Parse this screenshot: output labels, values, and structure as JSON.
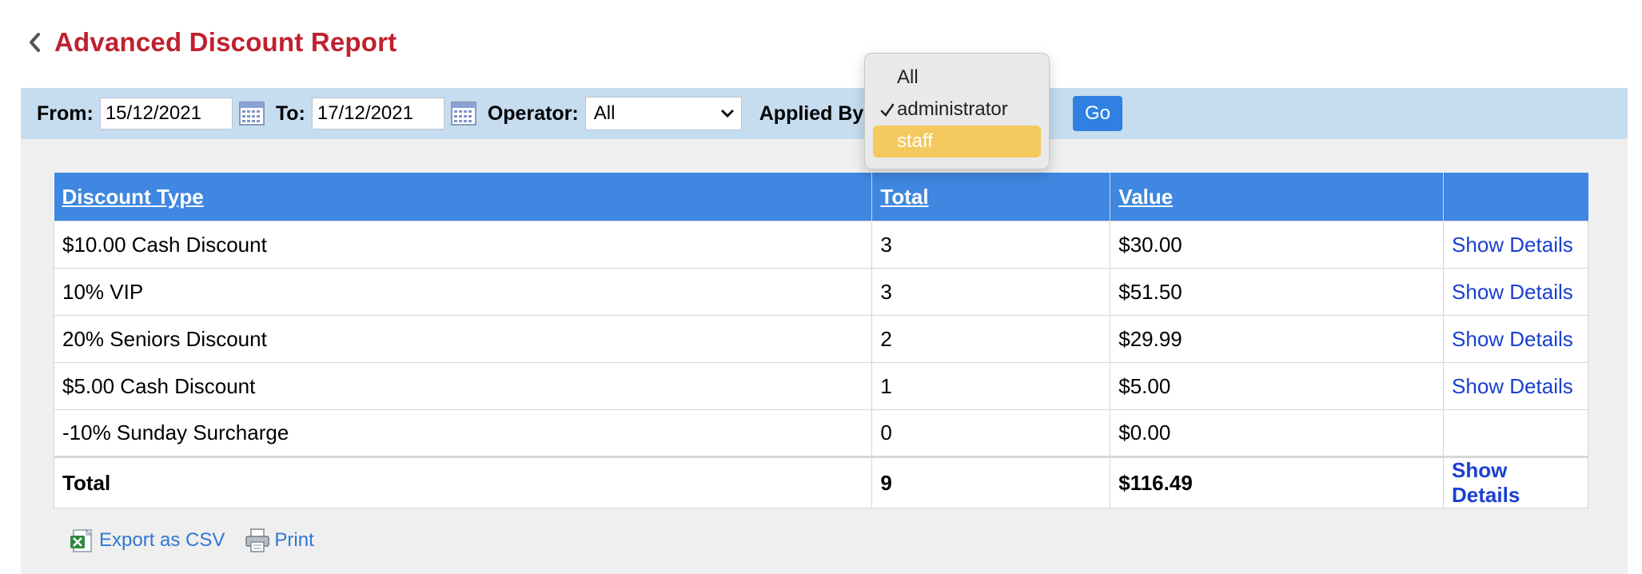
{
  "title": "Advanced Discount Report",
  "filters": {
    "from_label": "From:",
    "from_value": "15/12/2021",
    "to_label": "To:",
    "to_value": "17/12/2021",
    "operator_label": "Operator:",
    "operator_value": "All",
    "applied_by_label": "Applied By",
    "go_label": "Go"
  },
  "applied_by_dropdown": {
    "options": [
      "All",
      "administrator",
      "staff"
    ],
    "checked": "administrator",
    "highlighted": "staff"
  },
  "table": {
    "headers": [
      "Discount Type",
      "Total",
      "Value",
      ""
    ],
    "rows": [
      {
        "type": "$10.00 Cash Discount",
        "total": "3",
        "value": "$30.00",
        "action": "Show Details"
      },
      {
        "type": "10% VIP",
        "total": "3",
        "value": "$51.50",
        "action": "Show Details"
      },
      {
        "type": "20% Seniors Discount",
        "total": "2",
        "value": "$29.99",
        "action": "Show Details"
      },
      {
        "type": "$5.00 Cash Discount",
        "total": "1",
        "value": "$5.00",
        "action": "Show Details"
      },
      {
        "type": "-10% Sunday Surcharge",
        "total": "0",
        "value": "$0.00",
        "action": ""
      }
    ],
    "total_row": {
      "type": "Total",
      "total": "9",
      "value": "$116.49",
      "action": "Show Details"
    }
  },
  "footer": {
    "export_label": "Export as CSV",
    "print_label": "Print"
  },
  "colors": {
    "title": "#c0202f",
    "filter_bar": "#c6dcef",
    "header": "#3f87e0",
    "go_button": "#2f80e0",
    "link": "#1a3fcf",
    "highlight": "#f4c95d"
  }
}
